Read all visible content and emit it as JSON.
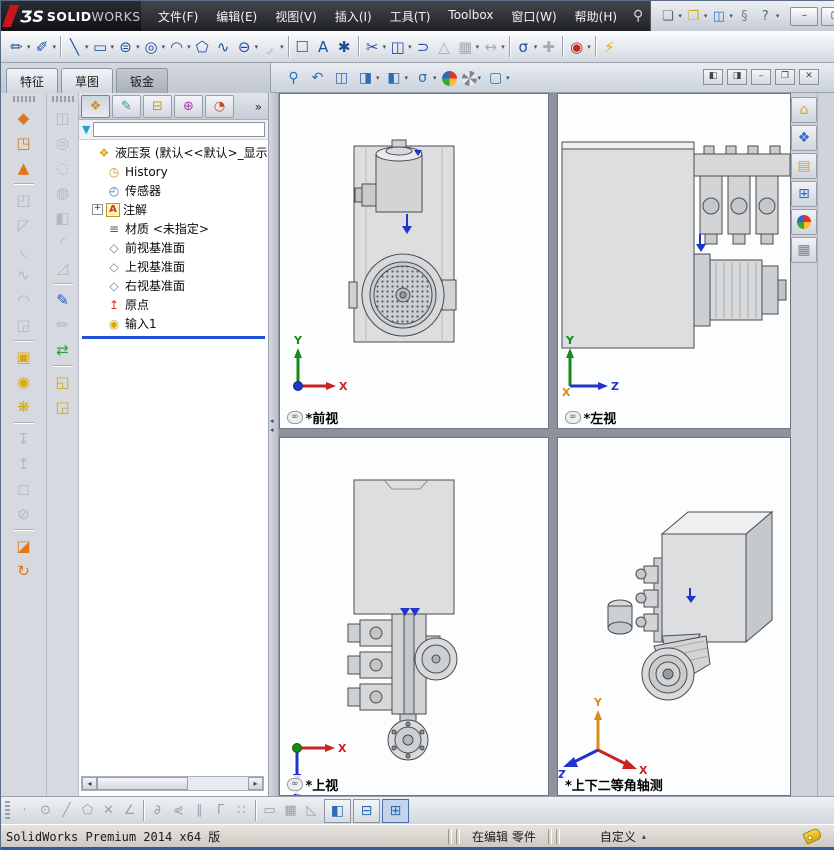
{
  "logo": {
    "mark": "ƷS",
    "solid": "SOLID",
    "works": "WORKS"
  },
  "header": {
    "search_glyph": "⚲"
  },
  "menus": [
    {
      "name": "menu-file",
      "label": "文件(F)"
    },
    {
      "name": "menu-edit",
      "label": "编辑(E)"
    },
    {
      "name": "menu-view",
      "label": "视图(V)"
    },
    {
      "name": "menu-insert",
      "label": "插入(I)"
    },
    {
      "name": "menu-tools",
      "label": "工具(T)"
    },
    {
      "name": "menu-toolbox",
      "label": "Toolbox"
    },
    {
      "name": "menu-window",
      "label": "窗口(W)"
    },
    {
      "name": "menu-help",
      "label": "帮助(H)"
    }
  ],
  "quick_access": [
    {
      "name": "new-document-icon",
      "glyph": "❏",
      "dd": "▾"
    },
    {
      "name": "open-document-icon",
      "glyph": "❐",
      "cls": "gold",
      "dd": "▾"
    },
    {
      "name": "save-icon",
      "glyph": "◫",
      "cls": "blue2",
      "dd": "▾"
    },
    {
      "name": "rebuild-icon",
      "glyph": "§",
      "cls": "gray2"
    },
    {
      "name": "help-icon",
      "glyph": "?",
      "dd": "▾"
    }
  ],
  "window_buttons": [
    {
      "name": "window-minimize-icon",
      "glyph": "–"
    },
    {
      "name": "window-maximize-icon",
      "glyph": "▢"
    },
    {
      "name": "window-close-icon",
      "glyph": "✕"
    }
  ],
  "sketch_toolbar": [
    {
      "name": "sketch-icon",
      "glyph": "✏",
      "dd": "▾"
    },
    {
      "name": "smart-dimension-icon",
      "glyph": "✐",
      "dd": "▾"
    },
    {
      "sep": true
    },
    {
      "name": "line-icon",
      "glyph": "╲",
      "dd": "▾"
    },
    {
      "name": "corner-rectangle-icon",
      "glyph": "▭",
      "dd": "▾"
    },
    {
      "name": "straight-slot-icon",
      "glyph": "⊜",
      "dd": "▾"
    },
    {
      "name": "circle-icon",
      "glyph": "◎",
      "dd": "▾"
    },
    {
      "name": "centerpoint-arc-icon",
      "glyph": "◠",
      "dd": "▾"
    },
    {
      "name": "polygon-icon",
      "glyph": "⬠"
    },
    {
      "name": "spline-icon",
      "glyph": "∿"
    },
    {
      "name": "ellipse-icon",
      "glyph": "⊖",
      "dd": "▾"
    },
    {
      "name": "sketch-fillet-icon",
      "glyph": "◞",
      "disabled": true,
      "dd": "▾"
    },
    {
      "sep": true
    },
    {
      "name": "selection-box-icon",
      "glyph": "☐"
    },
    {
      "name": "text-icon",
      "glyph": "A"
    },
    {
      "name": "point-icon",
      "glyph": "✱"
    },
    {
      "sep": true
    },
    {
      "name": "trim-entities-icon",
      "glyph": "✂",
      "dd": "▾"
    },
    {
      "name": "convert-entities-icon",
      "glyph": "◫",
      "dd": "▾"
    },
    {
      "name": "offset-entities-icon",
      "glyph": "⊃"
    },
    {
      "name": "mirror-entities-icon",
      "glyph": "△",
      "disabled": true
    },
    {
      "name": "linear-sketch-pattern-icon",
      "glyph": "▦",
      "disabled": true,
      "dd": "▾"
    },
    {
      "name": "move-entities-icon",
      "glyph": "↔",
      "disabled": true,
      "dd": "▾"
    },
    {
      "sep": true
    },
    {
      "name": "display-delete-relations-icon",
      "glyph": "σ",
      "dd": "▾"
    },
    {
      "name": "repair-sketch-icon",
      "glyph": "✚",
      "disabled": true
    },
    {
      "sep": true
    },
    {
      "name": "instant2d-icon",
      "glyph": "◉",
      "cls": "red",
      "dd": "▾"
    },
    {
      "sep": true
    },
    {
      "name": "rapid-sketch-icon",
      "glyph": "⚡",
      "cls": "yel2"
    }
  ],
  "command_tabs": [
    {
      "name": "tab-features",
      "label": "特征"
    },
    {
      "name": "tab-sketch",
      "label": "草图"
    },
    {
      "name": "tab-sheetmetal",
      "label": "钣金",
      "cls": "dark"
    }
  ],
  "headsup": [
    {
      "name": "zoom-fit-icon",
      "glyph": "⚲"
    },
    {
      "name": "previous-view-icon",
      "glyph": "↶"
    },
    {
      "name": "section-view-icon",
      "glyph": "◫"
    },
    {
      "name": "view-orientation-icon",
      "glyph": "◨",
      "dd": "▾"
    },
    {
      "name": "display-style-icon",
      "glyph": "◧",
      "dd": "▾"
    },
    {
      "name": "hide-show-items-icon",
      "glyph": "σ",
      "dd": "▾"
    },
    {
      "name": "edit-appearance-icon",
      "glyph": "●",
      "cls": "ballA"
    },
    {
      "name": "apply-scene-icon",
      "glyph": "◕",
      "cls": "ballB",
      "dd": "▾"
    },
    {
      "name": "view-settings-icon",
      "glyph": "▢",
      "dd": "▾"
    }
  ],
  "doc_buttons": [
    {
      "name": "pane-left-icon",
      "glyph": "◧"
    },
    {
      "name": "pane-right-icon",
      "glyph": "◨"
    },
    {
      "name": "doc-minimize-icon",
      "glyph": "–"
    },
    {
      "name": "doc-restore-icon",
      "glyph": "❐"
    },
    {
      "name": "doc-close-icon",
      "glyph": "✕"
    }
  ],
  "sheetmetal_toolbar": [
    {
      "name": "base-flange-icon",
      "glyph": "◆",
      "cls": "org"
    },
    {
      "name": "convert-to-sheetmetal-icon",
      "glyph": "◳",
      "cls": "org"
    },
    {
      "name": "lofted-bend-icon",
      "glyph": "▲",
      "cls": "org"
    },
    {
      "sep": true
    },
    {
      "name": "edge-flange-icon",
      "glyph": "◰",
      "disabled": true
    },
    {
      "name": "miter-flange-icon",
      "glyph": "◸",
      "disabled": true
    },
    {
      "name": "hem-icon",
      "glyph": "◟",
      "disabled": true
    },
    {
      "name": "jog-icon",
      "glyph": "∿",
      "disabled": true
    },
    {
      "name": "sketched-bend-icon",
      "glyph": "◠",
      "disabled": true
    },
    {
      "name": "closed-corner-icon",
      "glyph": "◲",
      "disabled": true,
      "dd": "▾"
    },
    {
      "sep": true
    },
    {
      "name": "extruded-cut-icon",
      "glyph": "▣",
      "cls": "yel"
    },
    {
      "name": "simple-hole-icon",
      "glyph": "◉",
      "cls": "yel"
    },
    {
      "name": "vent-icon",
      "glyph": "❋",
      "cls": "yel"
    },
    {
      "sep": true
    },
    {
      "name": "unfold-icon",
      "glyph": "↧",
      "disabled": true
    },
    {
      "name": "fold-icon",
      "glyph": "↥",
      "disabled": true
    },
    {
      "name": "flatten-icon",
      "glyph": "◻",
      "disabled": true
    },
    {
      "name": "no-bends-icon",
      "glyph": "⊘",
      "disabled": true
    },
    {
      "sep": true
    },
    {
      "name": "rip-icon",
      "glyph": "◪",
      "cls": "org"
    },
    {
      "name": "insert-bends-icon",
      "glyph": "↻",
      "cls": "org"
    }
  ],
  "features_toolbar": [
    {
      "name": "extruded-boss-icon",
      "glyph": "◫",
      "disabled": true
    },
    {
      "name": "revolved-boss-icon",
      "glyph": "◎",
      "disabled": true
    },
    {
      "name": "swept-boss-icon",
      "glyph": "◌",
      "disabled": true
    },
    {
      "name": "lofted-boss-icon",
      "glyph": "◍",
      "disabled": true
    },
    {
      "name": "boundary-boss-icon",
      "glyph": "◧",
      "disabled": true
    },
    {
      "name": "fillet-icon",
      "glyph": "◜",
      "disabled": true
    },
    {
      "name": "chamfer-icon",
      "glyph": "◿",
      "disabled": true
    },
    {
      "sep": true
    },
    {
      "name": "sketch-tool-icon",
      "glyph": "✎",
      "cls": "blu"
    },
    {
      "name": "3d-sketch-icon",
      "glyph": "✏",
      "disabled": true
    },
    {
      "name": "reference-geometry-icon",
      "glyph": "⇄",
      "cls": "grn"
    },
    {
      "sep": true
    },
    {
      "name": "instant3d-icon",
      "glyph": "◱",
      "cls": "yel"
    },
    {
      "name": "live-section-icon",
      "glyph": "◲",
      "cls": "yel"
    }
  ],
  "panel_tabs": [
    {
      "name": "featuremanager-tree-tab",
      "glyph": "❖",
      "cls": "gold",
      "active": true
    },
    {
      "name": "propertymanager-tab",
      "glyph": "✎",
      "cls": "teal"
    },
    {
      "name": "configurationmanager-tab",
      "glyph": "⊟",
      "cls": "gold"
    },
    {
      "name": "dimxpertmanager-tab",
      "glyph": "⊕",
      "cls": "purple"
    },
    {
      "name": "displaymanager-tab",
      "glyph": "◔",
      "cls": "multi"
    }
  ],
  "panel": {
    "chevron": "»",
    "filter_icon": "▼",
    "filter_value": ""
  },
  "feature_tree": {
    "root_icon": "❖",
    "root": "液压泵  (默认<<默认>_显示状态",
    "items": [
      {
        "name": "tree-item-history",
        "cls": "i-hist",
        "glyph": "◷",
        "label": "History"
      },
      {
        "name": "tree-item-sensors",
        "cls": "i-sens",
        "glyph": "◴",
        "label": "传感器"
      },
      {
        "name": "tree-item-annotations",
        "cls": "i-ann",
        "glyph": "A",
        "label": "注解",
        "exp": "+"
      },
      {
        "name": "tree-item-material",
        "cls": "i-mat",
        "glyph": "≡",
        "label": "材质 <未指定>"
      },
      {
        "name": "tree-item-front-plane",
        "cls": "i-pln",
        "glyph": "◇",
        "label": "前视基准面"
      },
      {
        "name": "tree-item-top-plane",
        "cls": "i-pln",
        "glyph": "◇",
        "label": "上视基准面"
      },
      {
        "name": "tree-item-right-plane",
        "cls": "i-pln",
        "glyph": "◇",
        "label": "右视基准面"
      },
      {
        "name": "tree-item-origin",
        "cls": "i-org",
        "glyph": "↥",
        "label": "原点"
      },
      {
        "name": "tree-item-imported1",
        "cls": "i-imp",
        "glyph": "◉",
        "label": "输入1"
      }
    ]
  },
  "scrollbar": {
    "left": "◂",
    "right": "▸"
  },
  "splitter_arrow": "◂",
  "task_pane": [
    {
      "name": "sw-resources-icon",
      "glyph": "⌂",
      "cls": "tgold"
    },
    {
      "name": "design-library-icon",
      "glyph": "❖",
      "cls": "tblue"
    },
    {
      "name": "file-explorer-icon",
      "glyph": "▤",
      "cls": "tgold"
    },
    {
      "name": "view-palette-icon",
      "glyph": "⊞",
      "cls": "tblue"
    },
    {
      "name": "appearances-icon",
      "glyph": "●",
      "cls": "tball"
    },
    {
      "name": "custom-properties-icon",
      "glyph": "▦",
      "cls": "tgray"
    }
  ],
  "viewports": [
    {
      "label": "*前视",
      "link": "∞"
    },
    {
      "label": "*左视",
      "link": "∞"
    },
    {
      "label": "*上视",
      "link": "∞"
    },
    {
      "label": "*上下二等角轴测"
    }
  ],
  "axes": {
    "x": "X",
    "y": "Y",
    "z": "Z"
  },
  "bottom_toolbar": [
    {
      "name": "snap-point-icon",
      "glyph": "·",
      "disabled": true
    },
    {
      "name": "snap-center-icon",
      "glyph": "⊙",
      "disabled": true
    },
    {
      "name": "snap-line-icon",
      "glyph": "╱",
      "disabled": true
    },
    {
      "name": "snap-polygon-icon",
      "glyph": "⬠",
      "disabled": true
    },
    {
      "name": "snap-intersection-icon",
      "glyph": "✕",
      "disabled": true
    },
    {
      "name": "snap-angle-icon",
      "glyph": "∠",
      "disabled": true
    },
    {
      "sep": true
    },
    {
      "name": "snap-tangent-icon",
      "glyph": "∂",
      "disabled": true
    },
    {
      "name": "snap-nearest-icon",
      "glyph": "⋞",
      "disabled": true
    },
    {
      "name": "snap-parallel-icon",
      "glyph": "∥",
      "disabled": true
    },
    {
      "name": "snap-perpendicular-icon",
      "glyph": "Γ",
      "disabled": true
    },
    {
      "name": "snap-points-icon",
      "glyph": "∷",
      "disabled": true
    },
    {
      "sep": true
    },
    {
      "name": "snap-length-icon",
      "glyph": "▭",
      "disabled": true
    },
    {
      "name": "grid-snap-icon",
      "glyph": "▦",
      "disabled": true
    },
    {
      "name": "snap-angle-grid-icon",
      "glyph": "◺",
      "disabled": true
    },
    {
      "name": "view-single-icon",
      "glyph": "◧",
      "cls": "vbtn"
    },
    {
      "name": "view-two-icon",
      "glyph": "⊟",
      "cls": "vbtn"
    },
    {
      "name": "view-four-icon",
      "glyph": "⊞",
      "cls": "vbtn",
      "active": true
    }
  ],
  "status_bar": {
    "product": "SolidWorks Premium 2014 x64 版",
    "editing": "在编辑 零件",
    "custom": "自定义",
    "custom_arrow": "▴"
  }
}
